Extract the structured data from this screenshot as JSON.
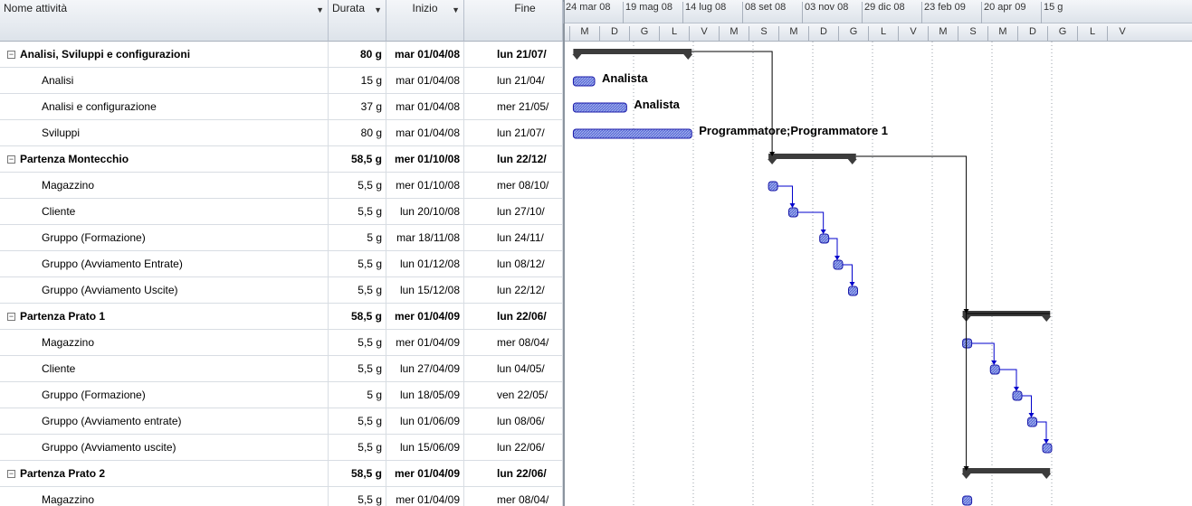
{
  "columns": {
    "name": "Nome attività",
    "duration": "Durata",
    "start": "Inizio",
    "finish": "Fine"
  },
  "timeline": {
    "top": [
      "24 mar 08",
      "19 mag 08",
      "14 lug 08",
      "08 set 08",
      "03 nov 08",
      "29 dic 08",
      "23 feb 09",
      "20 apr 09",
      "15 g"
    ],
    "bottom": [
      "M",
      "D",
      "G",
      "L",
      "V",
      "M",
      "S",
      "M",
      "D",
      "G",
      "L",
      "V",
      "M",
      "S",
      "M",
      "D",
      "G",
      "L",
      "V"
    ]
  },
  "tasks": [
    {
      "name": "Analisi, Sviluppi e configurazioni",
      "duration": "80 g",
      "start": "mar 01/04/08",
      "finish": "lun 21/07/",
      "summary": true
    },
    {
      "name": "Analisi",
      "duration": "15 g",
      "start": "mar 01/04/08",
      "finish": "lun 21/04/",
      "resource": "Analista"
    },
    {
      "name": "Analisi e configurazione",
      "duration": "37 g",
      "start": "mar 01/04/08",
      "finish": "mer 21/05/",
      "resource": "Analista"
    },
    {
      "name": "Sviluppi",
      "duration": "80 g",
      "start": "mar 01/04/08",
      "finish": "lun 21/07/",
      "resource": "Programmatore;Programmatore 1"
    },
    {
      "name": "Partenza Montecchio",
      "duration": "58,5 g",
      "start": "mer 01/10/08",
      "finish": "lun 22/12/",
      "summary": true
    },
    {
      "name": "Magazzino",
      "duration": "5,5 g",
      "start": "mer 01/10/08",
      "finish": "mer 08/10/"
    },
    {
      "name": "Cliente",
      "duration": "5,5 g",
      "start": "lun 20/10/08",
      "finish": "lun 27/10/"
    },
    {
      "name": "Gruppo (Formazione)",
      "duration": "5 g",
      "start": "mar 18/11/08",
      "finish": "lun 24/11/"
    },
    {
      "name": "Gruppo (Avviamento Entrate)",
      "duration": "5,5 g",
      "start": "lun 01/12/08",
      "finish": "lun 08/12/"
    },
    {
      "name": "Gruppo (Avviamento Uscite)",
      "duration": "5,5 g",
      "start": "lun 15/12/08",
      "finish": "lun 22/12/"
    },
    {
      "name": "Partenza Prato 1",
      "duration": "58,5 g",
      "start": "mer 01/04/09",
      "finish": "lun 22/06/",
      "summary": true
    },
    {
      "name": "Magazzino",
      "duration": "5,5 g",
      "start": "mer 01/04/09",
      "finish": "mer 08/04/"
    },
    {
      "name": "Cliente",
      "duration": "5,5 g",
      "start": "lun 27/04/09",
      "finish": "lun 04/05/"
    },
    {
      "name": "Gruppo (Formazione)",
      "duration": "5 g",
      "start": "lun 18/05/09",
      "finish": "ven 22/05/"
    },
    {
      "name": "Gruppo (Avviamento entrate)",
      "duration": "5,5 g",
      "start": "lun 01/06/09",
      "finish": "lun 08/06/"
    },
    {
      "name": "Gruppo (Avviamento uscite)",
      "duration": "5,5 g",
      "start": "lun 15/06/09",
      "finish": "lun 22/06/"
    },
    {
      "name": "Partenza Prato 2",
      "duration": "58,5 g",
      "start": "mer 01/04/09",
      "finish": "lun 22/06/",
      "summary": true
    },
    {
      "name": "Magazzino",
      "duration": "5,5 g",
      "start": "mer 01/04/09",
      "finish": "mer 08/04/"
    }
  ],
  "colors": {
    "task_bar": "#5b6fd6",
    "task_border": "#1a1aa8",
    "summary_bar": "#3c3c3c",
    "link_line": "#0000cc",
    "gridline": "#9aa0a8"
  }
}
